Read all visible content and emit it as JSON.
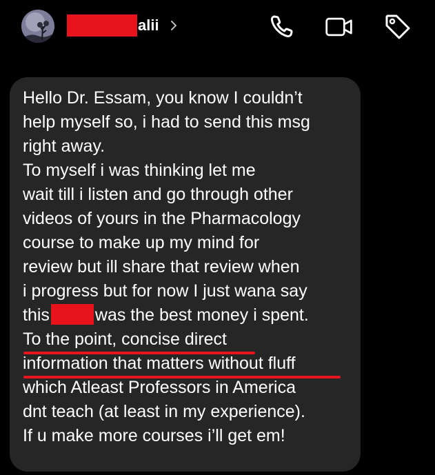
{
  "header": {
    "contact_name_suffix": "alii",
    "icons": {
      "back_chevron": "chevron-right-icon",
      "call": "phone-icon",
      "video": "video-camera-icon",
      "tag": "tag-icon"
    }
  },
  "message": {
    "lines": [
      "Hello Dr. Essam, you know I couldn’t",
      "help myself so, i had to send this msg",
      "right away.",
      "To myself i was thinking let me",
      "wait till i listen and go through other",
      "videos of yours in the Pharmacology",
      "course to make up my mind for",
      "review but ill share that review when",
      "i progress but for now I just wana say",
      "this",
      "was the best money i spent.",
      "To the point, concise direct",
      "information that matters without fluff",
      "which Atleast Professors in America",
      "dnt teach (at least in my experience).",
      "If u make more courses i’ll get em!"
    ]
  },
  "colors": {
    "background": "#000000",
    "bubble": "#262626",
    "text": "#ffffff",
    "redaction": "#e8141c",
    "highlight_underline": "#e8141c"
  }
}
